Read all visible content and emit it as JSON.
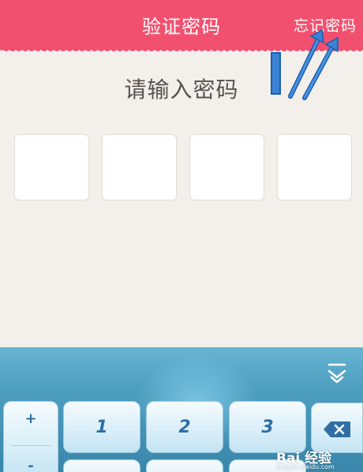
{
  "header": {
    "title": "验证密码",
    "forgot_label": "忘记密码"
  },
  "prompt": "请输入密码",
  "pin_boxes": [
    "",
    "",
    "",
    ""
  ],
  "keyboard": {
    "plus": "+",
    "minus": "-",
    "keys": [
      "1",
      "2",
      "3"
    ],
    "backspace_icon": "backspace-icon",
    "collapse_icon": "keyboard-collapse-icon"
  },
  "watermark": {
    "brand": "Bai 经验",
    "url": "jingyan.baidu.com"
  },
  "colors": {
    "header": "#f2506f",
    "background": "#f3efeb",
    "keyboard": "#4d9dbf",
    "key_text": "#2f6fa6",
    "annotation": "#3a82d4"
  }
}
